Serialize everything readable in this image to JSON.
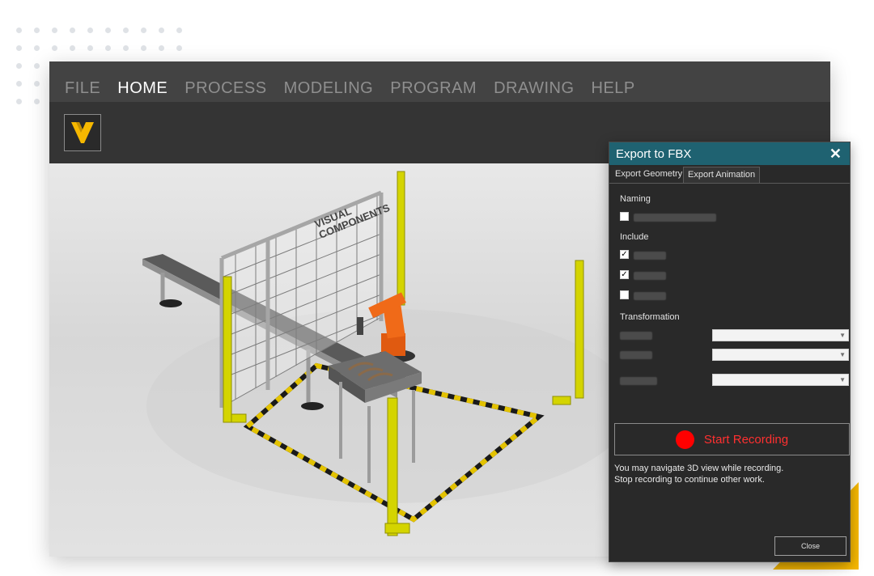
{
  "menu": {
    "items": [
      {
        "label": "FILE"
      },
      {
        "label": "HOME",
        "active": true
      },
      {
        "label": "PROCESS"
      },
      {
        "label": "MODELING"
      },
      {
        "label": "PROGRAM"
      },
      {
        "label": "DRAWING"
      },
      {
        "label": "HELP"
      }
    ]
  },
  "logo": {
    "icon": "visual-components-logo",
    "color": "#f6b800"
  },
  "scene": {
    "fence_brand_line1": "VISUAL",
    "fence_brand_line2": "COMPONENTS"
  },
  "dialog": {
    "title": "Export to FBX",
    "close_icon": "close-icon",
    "tabs": [
      {
        "label": "Export Geometry",
        "active": false
      },
      {
        "label": "Export Animation",
        "active": true
      }
    ],
    "naming_label": "Naming",
    "include_label": "Include",
    "transformation_label": "Transformation",
    "checkboxes": {
      "naming": false,
      "include_1": true,
      "include_2": true,
      "include_3": false
    },
    "record_label": "Start Recording",
    "info_line1": "You may navigate 3D view while recording.",
    "info_line2": "Stop recording to continue other work.",
    "close_label": "Close",
    "accent_color": "#1f6271",
    "record_color": "#ff0000"
  }
}
